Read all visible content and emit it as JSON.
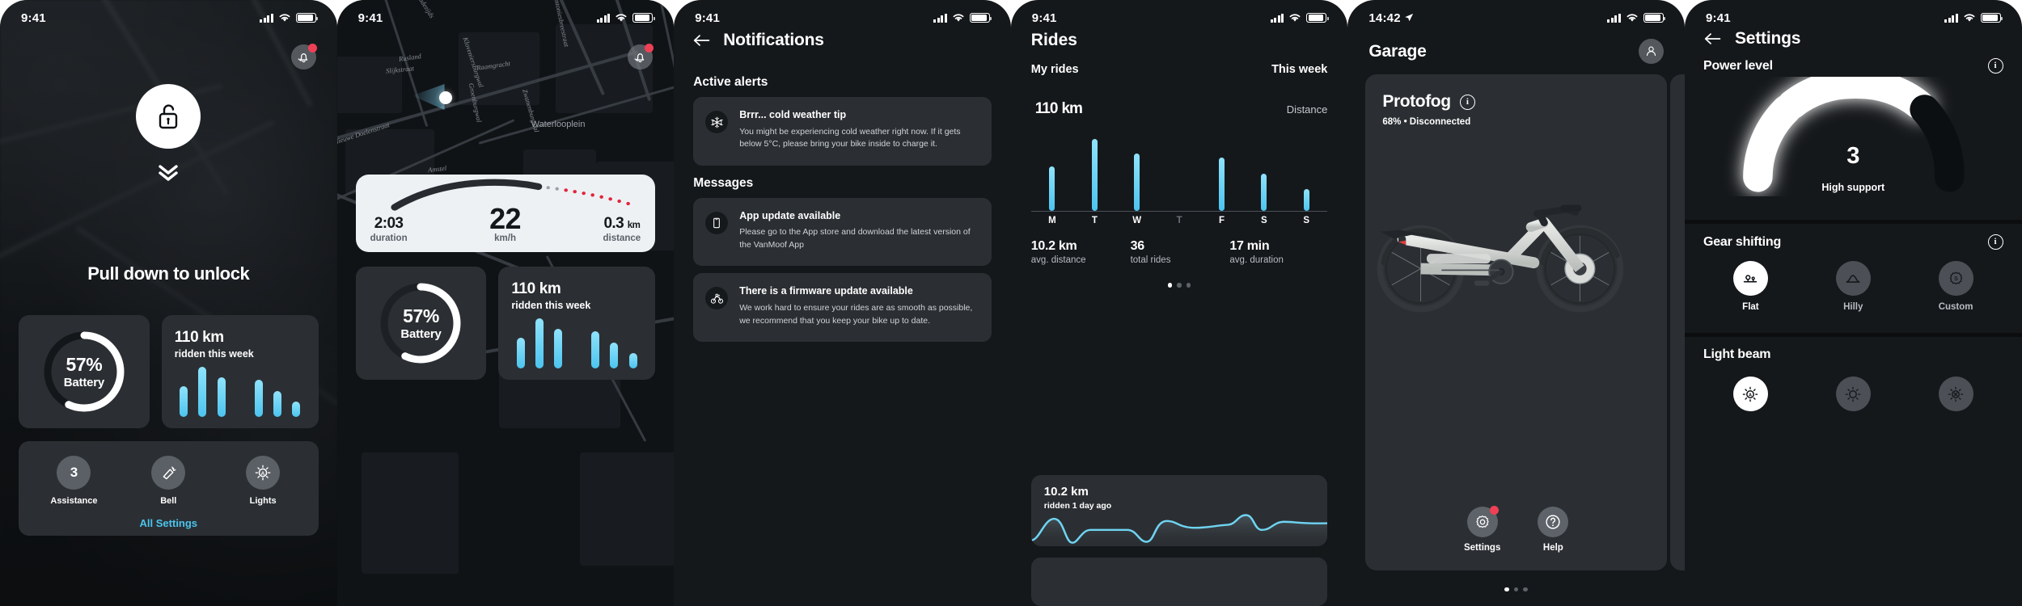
{
  "accent": "#4cc4ef",
  "alert_red": "#ef4056",
  "card_bg": "#2b2f33",
  "screen_bg": "#15181b",
  "screens": [
    {
      "name": "lock-screen",
      "status": {
        "time": "9:41",
        "signal": "signal-bars-icon",
        "wifi": "wifi-icon",
        "battery": "battery-icon"
      },
      "bell_button": "notifications-bell-button",
      "lock_icon": "unlocked-padlock-icon",
      "chevron_icon": "double-chevron-down-icon",
      "pull_label": "Pull down to unlock",
      "battery_card": {
        "percent": "57%",
        "label": "Battery",
        "value": 57
      },
      "week_card": {
        "value": "110 km",
        "sub": "ridden this week",
        "bars": [
          48,
          78,
          62,
          0,
          58,
          40,
          24
        ]
      },
      "quick": [
        {
          "label": "Assistance",
          "icon": "assistance-level-3",
          "value": "3"
        },
        {
          "label": "Bell",
          "icon": "bell-horn-icon",
          "value": ""
        },
        {
          "label": "Lights",
          "icon": "light-auto-icon",
          "value": ""
        }
      ],
      "all_settings": "All Settings"
    },
    {
      "name": "ride-screen",
      "status": {
        "time": "9:41"
      },
      "bell_button": "notifications-bell-button",
      "map": {
        "street_labels": [
          "Oudezijds",
          "Sint Antoniesbreestraat",
          "Rusland",
          "Slijkstraat",
          "Kloveniersburgwal",
          "Raamgracht",
          "Groenburgwal",
          "Zwanenburgwal",
          "Nieuwe Doelenstraat",
          "Amstel",
          "Waterlooplein"
        ],
        "location_marker": "current-position-marker"
      },
      "speed_card": {
        "duration_value": "2:03",
        "duration_label": "duration",
        "speed_value": "22",
        "speed_label": "km/h",
        "distance_value": "0.3",
        "distance_unit": "km",
        "distance_label": "distance"
      },
      "battery_card": {
        "percent": "57%",
        "label": "Battery",
        "value": 57
      },
      "week_card": {
        "value": "110 km",
        "sub": "ridden this week",
        "bars": [
          48,
          78,
          62,
          0,
          58,
          40,
          24
        ]
      }
    },
    {
      "name": "notifications-screen",
      "status": {
        "time": "9:41"
      },
      "back_icon": "arrow-left-icon",
      "title": "Notifications",
      "sections": [
        {
          "label": "Active alerts",
          "items": [
            {
              "icon": "snowflake-icon",
              "title": "Brrr... cold weather tip",
              "body": "You might be experiencing cold weather right now. If it gets below 5°C, please bring your bike inside to charge it."
            }
          ]
        },
        {
          "label": "Messages",
          "items": [
            {
              "icon": "mobile-phone-icon",
              "title": "App update available",
              "body": "Please go to the App store and download the latest version of the VanMoof App"
            },
            {
              "icon": "bicycle-icon",
              "title": "There is a firmware update available",
              "body": "We work hard to ensure your rides are as smooth as possible, we recommend that you keep your bike up to date."
            }
          ]
        }
      ]
    },
    {
      "name": "rides-screen",
      "status": {
        "time": "9:41"
      },
      "title": "Rides",
      "subtitle": "My rides",
      "period": "This week",
      "distance_value": "110",
      "distance_unit": "km",
      "distance_caption": "Distance",
      "stats": [
        {
          "value": "10.2 km",
          "label": "avg. distance"
        },
        {
          "value": "36",
          "label": "total rides"
        },
        {
          "value": "17 min",
          "label": "avg. duration"
        }
      ],
      "page_dots": {
        "count": 3,
        "active": 0
      },
      "recent_ride": {
        "value": "10.2 km",
        "label": "ridden 1 day ago"
      }
    },
    {
      "name": "garage-screen",
      "status": {
        "time": "14:42",
        "location_icon": "location-arrow-icon"
      },
      "title": "Garage",
      "profile_icon": "person-avatar-icon",
      "bike": {
        "name": "Protofog",
        "info_icon": "info-circle-icon",
        "status": "68% • Disconnected",
        "image": "white-ebike-side-view"
      },
      "actions": [
        {
          "icon": "gear-icon",
          "label": "Settings",
          "badge": true
        },
        {
          "icon": "question-circle-icon",
          "label": "Help",
          "badge": false
        }
      ],
      "page_dots": {
        "count": 3,
        "active": 0
      }
    },
    {
      "name": "settings-screen",
      "status": {
        "time": "9:41"
      },
      "back_icon": "arrow-left-icon",
      "title": "Settings",
      "power": {
        "label": "Power level",
        "info_icon": "info-circle-icon",
        "value": "3",
        "caption": "High support",
        "segments": 4,
        "active_segments": 3
      },
      "gear": {
        "label": "Gear shifting",
        "info_icon": "info-circle-icon",
        "options": [
          {
            "label": "Flat",
            "icon": "flat-terrain-icon",
            "selected": true
          },
          {
            "label": "Hilly",
            "icon": "hill-terrain-icon",
            "selected": false
          },
          {
            "label": "Custom",
            "icon": "custom-gear-icon",
            "selected": false
          }
        ]
      },
      "light": {
        "label": "Light beam",
        "options": [
          {
            "label": "",
            "icon": "light-auto-icon",
            "selected": true
          },
          {
            "label": "",
            "icon": "light-on-icon",
            "selected": false
          },
          {
            "label": "",
            "icon": "light-off-icon",
            "selected": false
          }
        ]
      }
    }
  ],
  "chart_data": [
    {
      "type": "bar",
      "title": "110 km ridden this week",
      "categories": [
        "M",
        "T",
        "W",
        "T",
        "F",
        "S",
        "S"
      ],
      "values": [
        48,
        78,
        62,
        0,
        58,
        40,
        24
      ],
      "xlabel": "",
      "ylabel": "km",
      "ylim": [
        0,
        90
      ],
      "grid": false,
      "legend": "none",
      "notes": "Weekly distance mini bar chart shown on lock screen and ride screen cards; Thursday has no ride."
    },
    {
      "type": "bar",
      "title": "My rides — This week — 110 km Distance",
      "categories": [
        "M",
        "T",
        "W",
        "T",
        "F",
        "S",
        "S"
      ],
      "values": [
        48,
        78,
        62,
        0,
        58,
        40,
        24
      ],
      "xlabel": "",
      "ylabel": "Distance (km)",
      "ylim": [
        0,
        90
      ],
      "grid": false,
      "legend": "none",
      "annotations": [
        "10.2 km avg. distance",
        "36 total rides",
        "17 min avg. duration"
      ]
    },
    {
      "type": "area",
      "title": "10.2 km ridden 1 day ago",
      "x": [
        0,
        1,
        2,
        3,
        4,
        5,
        6,
        7,
        8,
        9,
        10,
        11,
        12,
        13,
        14,
        15,
        16,
        17,
        18,
        19
      ],
      "y": [
        8,
        40,
        46,
        20,
        4,
        30,
        30,
        30,
        30,
        12,
        18,
        54,
        50,
        42,
        42,
        44,
        66,
        30,
        48,
        50
      ],
      "xlabel": "",
      "ylabel": "speed",
      "ylim": [
        0,
        70
      ],
      "grid": false,
      "legend": "none"
    },
    {
      "type": "pie",
      "title": "Battery",
      "categories": [
        "charged",
        "remaining"
      ],
      "values": [
        57,
        43
      ],
      "labels": [
        "57%",
        ""
      ],
      "notes": "Radial progress ring, 57% battery"
    },
    {
      "type": "bar",
      "title": "Power level gauge",
      "categories": [
        "1",
        "2",
        "3",
        "4"
      ],
      "values": [
        1,
        1,
        1,
        0
      ],
      "labels": [
        "3",
        "High support"
      ],
      "notes": "Semi-circular 4-segment gauge with 3 of 4 segments lit"
    }
  ]
}
